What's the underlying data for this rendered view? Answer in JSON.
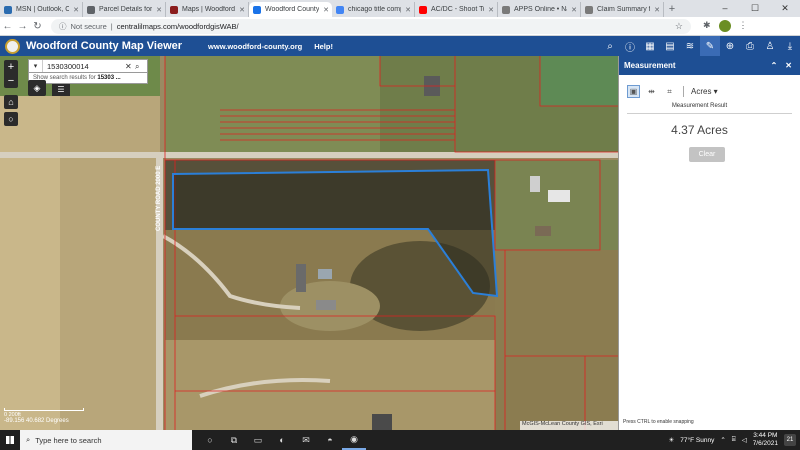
{
  "browser": {
    "tabs": [
      {
        "title": "MSN | Outlook, Off",
        "color": "#2b6cb0"
      },
      {
        "title": "Parcel Details for W",
        "color": "#5f6368"
      },
      {
        "title": "Maps | Woodford C",
        "color": "#8b1d1d"
      },
      {
        "title": "Woodford County M",
        "color": "#1a73e8"
      },
      {
        "title": "chicago title comp",
        "color": "#4285f4"
      },
      {
        "title": "AC/DC - Shoot To T",
        "color": "#ff0000"
      },
      {
        "title": "APPS Online • Nav",
        "color": "#7a7a7a"
      },
      {
        "title": "Claim Summary for",
        "color": "#7a7a7a"
      }
    ],
    "new_tab": "+",
    "security_label": "Not secure",
    "url": "centralilmaps.com/woodfordgisWAB/"
  },
  "app": {
    "title": "Woodford County Map Viewer",
    "link_site": "www.woodford-county.org",
    "link_help": "Help!"
  },
  "search": {
    "value": "1530300014",
    "suggestion_prefix": "Show search results for ",
    "suggestion_term": "15303 ..."
  },
  "map": {
    "road_label": "COUNTY ROAD 2000 E",
    "scale_label": "0  200ft",
    "coordinates": "-89.156 40.682 Degrees",
    "attribution": "McGIS-McLean County GIS, Esri"
  },
  "measurement": {
    "panel_title": "Measurement",
    "unit": "Acres",
    "result_label": "Measurement Result",
    "result_value": "4.37 Acres",
    "clear_label": "Clear",
    "snap_note": "Press CTRL to enable snapping"
  },
  "taskbar": {
    "search_placeholder": "Type here to search",
    "weather": "77°F  Sunny",
    "time": "3:44 PM",
    "date": "7/6/2021",
    "notifications": "21"
  }
}
